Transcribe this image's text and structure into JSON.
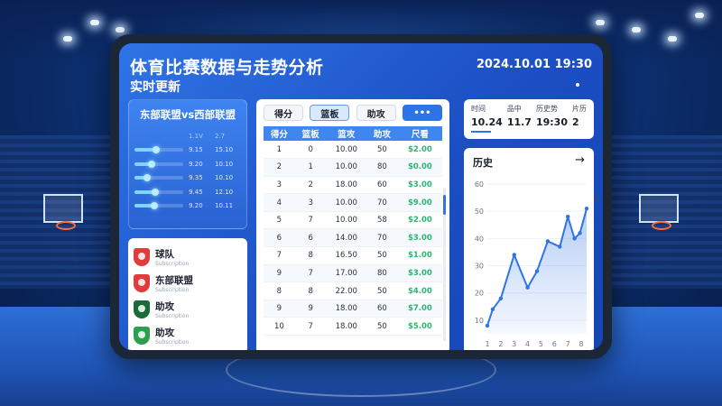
{
  "header": {
    "title": "体育比赛数据与走势分析",
    "subtitle": "实时更新",
    "datetime": "2024.10.01 19:30"
  },
  "matchup": {
    "title": "东部联盟vs西部联盟",
    "col_a": "1.1V",
    "col_b": "2.7",
    "rows": [
      {
        "a": "9.15",
        "b": "15.10",
        "level": 0.45
      },
      {
        "a": "9.20",
        "b": "10.10",
        "level": 0.35
      },
      {
        "a": "9.35",
        "b": "10.10",
        "level": 0.25
      },
      {
        "a": "9.45",
        "b": "12.10",
        "level": 0.42
      },
      {
        "a": "9.20",
        "b": "10.11",
        "level": 0.4
      }
    ]
  },
  "legend": {
    "items": [
      {
        "name": "球队",
        "sub": "Subscription",
        "color": "#e23b3b"
      },
      {
        "name": "东部联盟",
        "sub": "Subscription",
        "color": "#e23b3b"
      },
      {
        "name": "助攻",
        "sub": "Subscription",
        "color": "#1a6b3a"
      },
      {
        "name": "助攻",
        "sub": "Subscription",
        "color": "#2da04f"
      }
    ]
  },
  "tabs": {
    "t1": "得分",
    "t2": "篮板",
    "t3": "助攻",
    "more": "•••"
  },
  "table": {
    "headers": [
      "得分",
      "篮板",
      "篮攻",
      "助攻",
      "尺看"
    ],
    "rows": [
      [
        "1",
        "0",
        "10.00",
        "50",
        "$2.00"
      ],
      [
        "2",
        "1",
        "10.00",
        "80",
        "$0.00"
      ],
      [
        "3",
        "2",
        "18.00",
        "60",
        "$3.00"
      ],
      [
        "4",
        "3",
        "10.00",
        "70",
        "$9.00"
      ],
      [
        "5",
        "7",
        "10.00",
        "58",
        "$2.00"
      ],
      [
        "6",
        "6",
        "14.00",
        "70",
        "$3.00"
      ],
      [
        "7",
        "8",
        "16.50",
        "50",
        "$1.00"
      ],
      [
        "9",
        "7",
        "17.00",
        "80",
        "$3.00"
      ],
      [
        "8",
        "8",
        "22.00",
        "50",
        "$4.00"
      ],
      [
        "9",
        "9",
        "18.00",
        "60",
        "$7.00"
      ],
      [
        "10",
        "7",
        "18.00",
        "50",
        "$5.00"
      ]
    ]
  },
  "stats": [
    {
      "label": "时间",
      "value": "10.24"
    },
    {
      "label": "品中",
      "value": "11.7"
    },
    {
      "label": "历史势",
      "value": "19:30"
    },
    {
      "label": "片历",
      "value": "2"
    }
  ],
  "history": {
    "title": "历史",
    "arrow": "→"
  },
  "chart_data": {
    "type": "area",
    "title": "历史",
    "x": [
      1,
      1.4,
      2,
      3,
      4,
      4.7,
      5.5,
      6.4,
      7,
      7.5,
      7.9,
      8.4
    ],
    "y": [
      8,
      14,
      18,
      34,
      22,
      28,
      39,
      37,
      48,
      40,
      42,
      51
    ],
    "xticks": [
      "1",
      "2",
      "3",
      "4",
      "5",
      "6",
      "7",
      "8"
    ],
    "yticks": [
      "10",
      "20",
      "30",
      "40",
      "50",
      "60"
    ],
    "xlim": [
      1,
      8.4
    ],
    "ylim": [
      5,
      60
    ],
    "color": "#2f74e6"
  }
}
